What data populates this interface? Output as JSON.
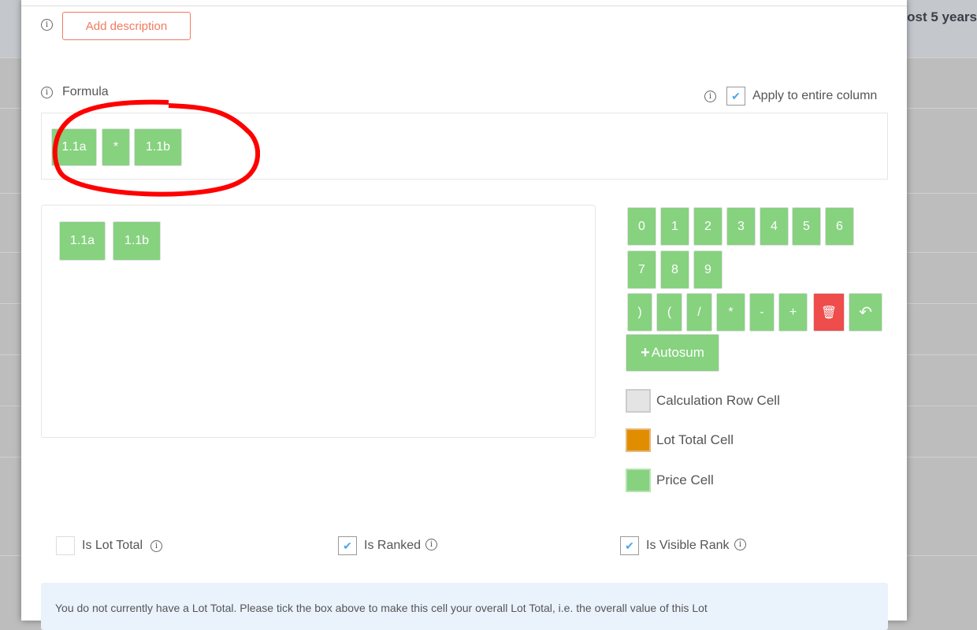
{
  "background": {
    "partial_text": "ost 5 years"
  },
  "description": {
    "button": "Add description"
  },
  "formula": {
    "label": "Formula",
    "apply_label": "Apply to entire column",
    "apply_checked": true,
    "tokens": [
      "1.1a",
      "*",
      "1.1b"
    ]
  },
  "available_cells": [
    "1.1a",
    "1.1b"
  ],
  "keypad": {
    "digits": [
      "0",
      "1",
      "2",
      "3",
      "4",
      "5",
      "6",
      "7",
      "8",
      "9"
    ],
    "operators": [
      ")",
      "(",
      "/",
      "*",
      "-",
      "+"
    ],
    "autosum": "Autosum"
  },
  "legend": [
    {
      "label": "Calculation Row Cell",
      "color": "#e4e4e4"
    },
    {
      "label": "Lot Total Cell",
      "color": "#e08e00"
    },
    {
      "label": "Price Cell",
      "color": "#86d27f"
    }
  ],
  "options": [
    {
      "label": "Is Lot Total",
      "checked": false
    },
    {
      "label": "Is Ranked",
      "checked": true
    },
    {
      "label": "Is Visible Rank",
      "checked": true
    }
  ],
  "note": "You do not currently have a Lot Total. Please tick the box above to make this cell your overall Lot Total, i.e. the overall value of this Lot"
}
